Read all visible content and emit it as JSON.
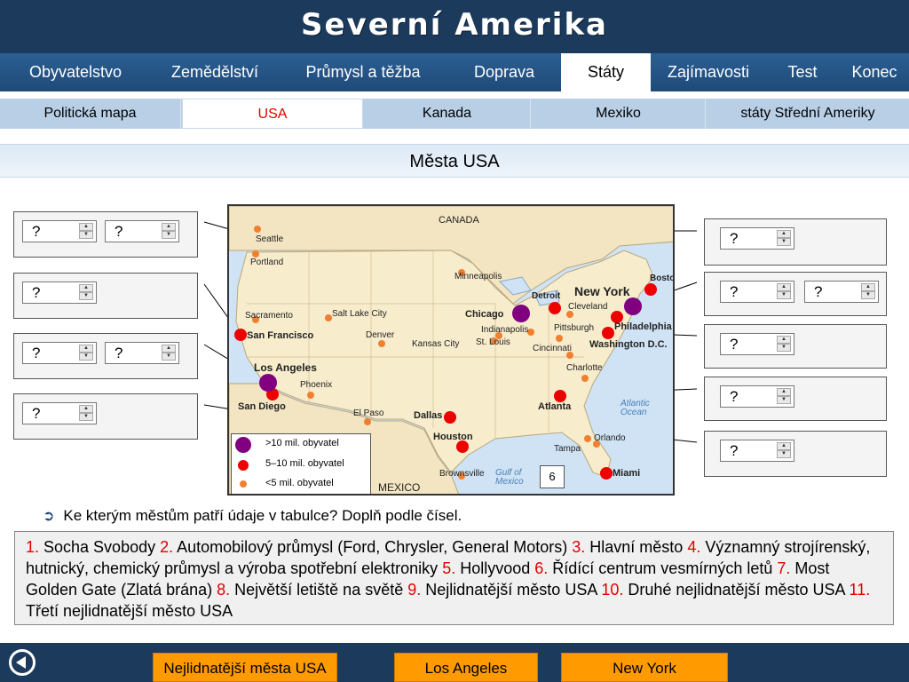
{
  "header": {
    "title": "Severní Amerika"
  },
  "nav": {
    "items": [
      {
        "label": "Obyvatelstvo"
      },
      {
        "label": "Zemědělství"
      },
      {
        "label": "Průmysl a těžba"
      },
      {
        "label": "Doprava"
      },
      {
        "label": "Státy",
        "active": true
      },
      {
        "label": "Zajímavosti"
      },
      {
        "label": "Test"
      },
      {
        "label": "Konec"
      }
    ]
  },
  "subnav": {
    "items": [
      {
        "label": "Politická mapa"
      },
      {
        "label": "USA",
        "active": true
      },
      {
        "label": "Kanada"
      },
      {
        "label": "Mexiko"
      },
      {
        "label": "státy Střední Ameriky"
      }
    ]
  },
  "section": {
    "title": "Města USA"
  },
  "answers": {
    "placeholder": "?"
  },
  "map": {
    "labels": {
      "canada": "CANADA",
      "mexico": "MEXICO",
      "atlantic": "Atlantic Ocean",
      "gulf": "Gulf of Mexico"
    },
    "cities": {
      "seattle": "Seattle",
      "portland": "Portland",
      "sacramento": "Sacramento",
      "san_francisco": "San Francisco",
      "los_angeles": "Los Angeles",
      "san_diego": "San Diego",
      "phoenix": "Phoenix",
      "salt_lake_city": "Salt Lake City",
      "denver": "Denver",
      "el_paso": "El Paso",
      "minneapolis": "Minneapolis",
      "chicago": "Chicago",
      "detroit": "Detroit",
      "new_york": "New York",
      "boston": "Boston",
      "cleveland": "Cleveland",
      "pittsburgh": "Pittsburgh",
      "philadelphia": "Philadelphia",
      "washington": "Washington D.C.",
      "indianapolis": "Indianapolis",
      "kansas_city": "Kansas City",
      "st_louis": "St. Louis",
      "cincinnati": "Cincinnati",
      "charlotte": "Charlotte",
      "atlanta": "Atlanta",
      "dallas": "Dallas",
      "houston": "Houston",
      "brownsville": "Brownsville",
      "tampa": "Tampa",
      "orlando": "Orlando",
      "miami": "Miami"
    },
    "legend": {
      "big": ">10 mil. obyvatel",
      "mid": "5–10 mil. obyvatel",
      "small": "<5 mil. obyvatel"
    },
    "six": "6"
  },
  "instruction": "Ke kterým městům patří údaje v tabulce? Doplň podle čísel.",
  "clues": [
    {
      "n": "1.",
      "t": " Socha Svobody "
    },
    {
      "n": "2.",
      "t": " Automobilový průmysl (Ford, Chrysler, General Motors) "
    },
    {
      "n": "3.",
      "t": " Hlavní město "
    },
    {
      "n": "4.",
      "t": " Významný strojírenský, hutnický, chemický průmysl a výroba spotřební elektroniky "
    },
    {
      "n": "5.",
      "t": " Hollyvood "
    },
    {
      "n": "6.",
      "t": " Řídící centrum vesmírných letů  "
    },
    {
      "n": "7.",
      "t": " Most Golden Gate (Zlatá brána) "
    },
    {
      "n": "8.",
      "t": " Největší letiště na světě  "
    },
    {
      "n": "9.",
      "t": " Nejlidnatější město USA "
    },
    {
      "n": "10.",
      "t": " Druhé nejlidnatější město USA "
    },
    {
      "n": "11.",
      "t": " Třetí nejlidnatější město USA"
    }
  ],
  "footer": {
    "buttons": [
      "Nejlidnatější města USA",
      "Los Angeles",
      "New York"
    ]
  },
  "colors": {
    "header_bg": "#1c3a5c",
    "nav_bg": "#2c5f93",
    "accent_red": "#e00000",
    "orange": "#ff9a00",
    "big_city": "#800080",
    "mid_city": "#ee0000",
    "small_city": "#f08030"
  }
}
